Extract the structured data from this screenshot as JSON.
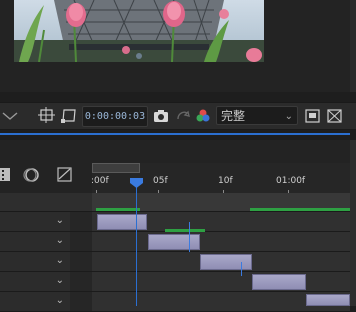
{
  "viewer": {
    "image": "eiffel-tower-with-pink-tulips"
  },
  "toolbar": {
    "timecode": "0:00:00:03",
    "resolution": "完整",
    "icons": [
      "region-of-interest-icon",
      "transparency-grid-icon",
      "camera-snapshot-icon",
      "show-snapshot-icon",
      "color-channels-icon",
      "toggle-mask-icon",
      "3d-view-icon"
    ]
  },
  "timeline": {
    "ruler_labels": [
      ":00f",
      "05f",
      "10f",
      "01:00f"
    ],
    "layer_count": 5,
    "colors": {
      "clip": "#a9a8c9",
      "playhead": "#2b6fd1",
      "work_area": "#2ea043"
    }
  }
}
